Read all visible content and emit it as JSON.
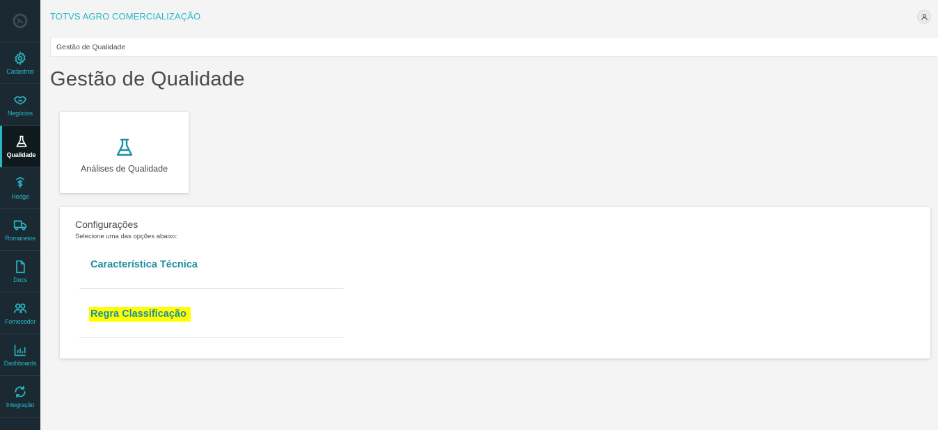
{
  "header": {
    "company": "TOTVS AGRO COMERCIALIZAÇÃO"
  },
  "breadcrumb": "Gestão de Qualidade",
  "page_title": "Gestão de Qualidade",
  "sidebar": {
    "items": [
      {
        "label": "Cadastros",
        "icon": "gear-icon"
      },
      {
        "label": "Negócios",
        "icon": "handshake-icon"
      },
      {
        "label": "Qualidade",
        "icon": "flask-icon",
        "active": true
      },
      {
        "label": "Hedge",
        "icon": "hedge-dollar-icon"
      },
      {
        "label": "Romaneios",
        "icon": "truck-icon"
      },
      {
        "label": "Docs",
        "icon": "document-icon"
      },
      {
        "label": "Fornecedor",
        "icon": "users-icon"
      },
      {
        "label": "Dashboards",
        "icon": "bar-chart-icon"
      },
      {
        "label": "Integração",
        "icon": "sync-icon"
      }
    ]
  },
  "card": {
    "label": "Análises de Qualidade",
    "icon": "flask-icon"
  },
  "config": {
    "title": "Configurações",
    "subtitle": "Selecione uma das opções abaixo:",
    "options": [
      {
        "label": "Característica Técnica"
      },
      {
        "label": "Regra Classificação",
        "highlight": "#ffff00"
      }
    ]
  },
  "colors": {
    "accent": "#29b6c5",
    "link": "#1e8ea3",
    "sidebar_bg": "#1b2a32"
  }
}
